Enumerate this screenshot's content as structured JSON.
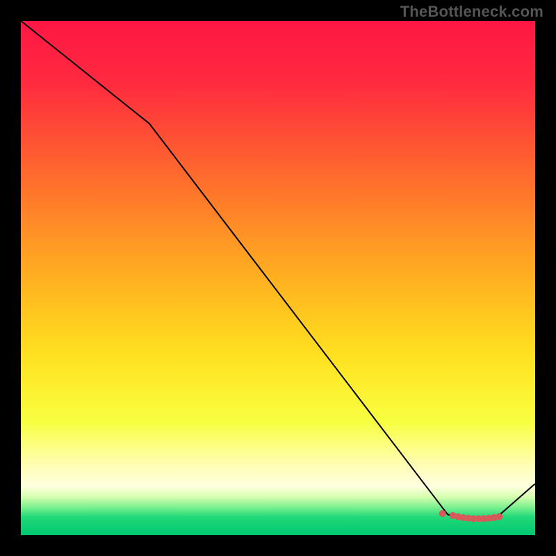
{
  "watermark": "TheBottleneck.com",
  "chart_data": {
    "type": "line",
    "title": "",
    "xlabel": "",
    "ylabel": "",
    "xlim": [
      0,
      100
    ],
    "ylim": [
      0,
      100
    ],
    "grid": false,
    "legend": false,
    "curve": {
      "name": "bottleneck-curve",
      "color": "#000000",
      "x": [
        0,
        25,
        83,
        87,
        92,
        100
      ],
      "y": [
        100,
        80,
        4,
        3,
        3,
        10
      ]
    },
    "markers": {
      "name": "optimal-range",
      "color": "#d65a5a",
      "x": [
        82,
        84,
        85,
        86,
        87,
        88,
        89,
        90,
        91,
        92,
        93
      ],
      "y": [
        4.2,
        3.8,
        3.6,
        3.4,
        3.3,
        3.2,
        3.2,
        3.2,
        3.3,
        3.4,
        3.6
      ]
    },
    "background_gradient": {
      "stops": [
        {
          "offset": 0.0,
          "color": "#ff1744"
        },
        {
          "offset": 0.12,
          "color": "#ff2a3f"
        },
        {
          "offset": 0.3,
          "color": "#ff6a2d"
        },
        {
          "offset": 0.5,
          "color": "#ffb020"
        },
        {
          "offset": 0.65,
          "color": "#ffe120"
        },
        {
          "offset": 0.78,
          "color": "#f8ff40"
        },
        {
          "offset": 0.86,
          "color": "#fffdb0"
        },
        {
          "offset": 0.905,
          "color": "#ffffe0"
        },
        {
          "offset": 0.925,
          "color": "#d8ffb0"
        },
        {
          "offset": 0.945,
          "color": "#80f090"
        },
        {
          "offset": 0.965,
          "color": "#20d878"
        },
        {
          "offset": 1.0,
          "color": "#00c870"
        }
      ]
    }
  }
}
